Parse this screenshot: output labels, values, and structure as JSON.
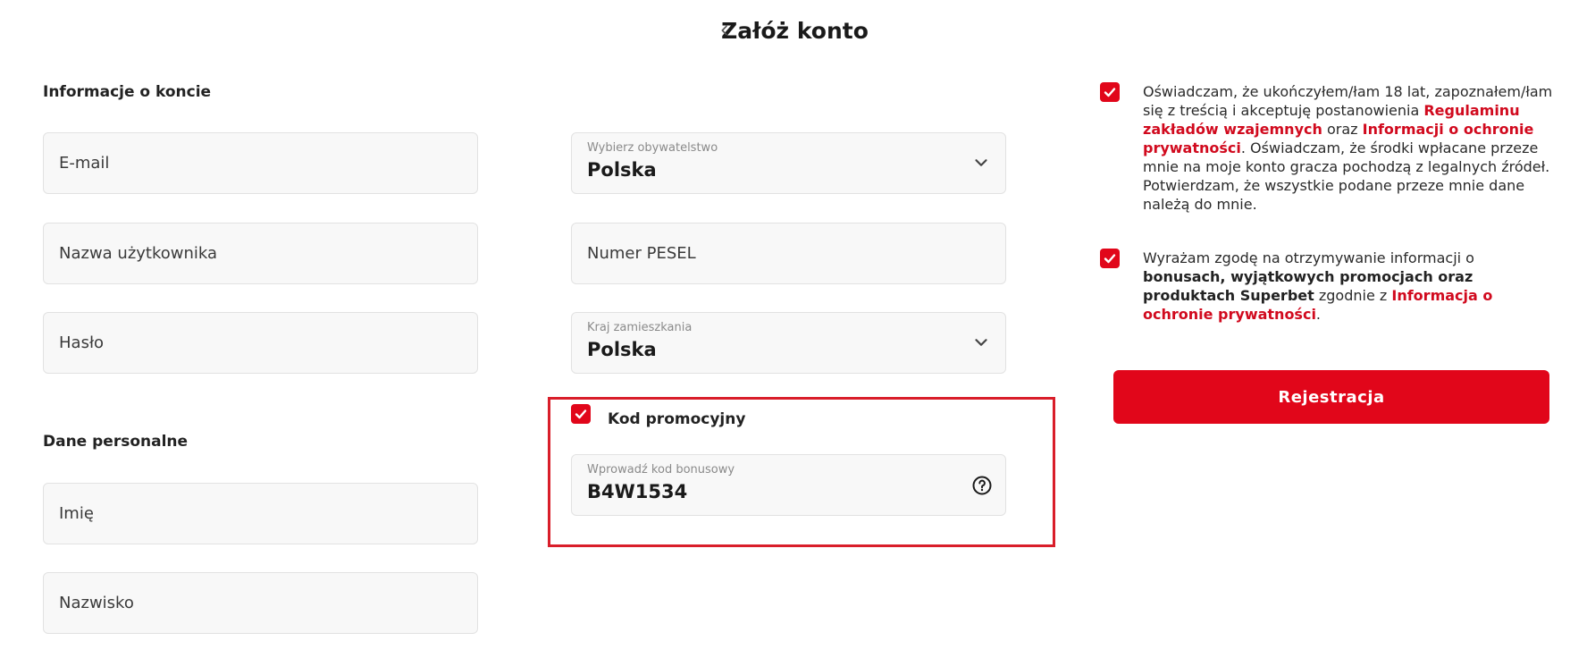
{
  "header": {
    "title": "Załóż konto",
    "back_icon": "chevron-left-icon"
  },
  "account_info": {
    "section_title": "Informacje o koncie",
    "email_placeholder": "E-mail",
    "username_placeholder": "Nazwa użytkownika",
    "password_placeholder": "Hasło"
  },
  "personal_data": {
    "section_title": "Dane personalne",
    "first_name_placeholder": "Imię",
    "last_name_placeholder": "Nazwisko"
  },
  "citizenship": {
    "label": "Wybierz obywatelstwo",
    "value": "Polska"
  },
  "pesel": {
    "placeholder": "Numer PESEL"
  },
  "residence": {
    "label": "Kraj zamieszkania",
    "value": "Polska"
  },
  "promo": {
    "checkbox_label": "Kod promocyjny",
    "checked": true,
    "code_label": "Wprowadź kod bonusowy",
    "code_value": "B4W1534",
    "highlight_color": "#d91e2a"
  },
  "consents": {
    "terms": {
      "checked": true,
      "text_1": "Oświadczam, że ukończyłem/łam 18 lat, zapoznałem/łam się z treścią i akceptuję postanowienia ",
      "link_1": "Regulaminu zakładów wzajemnych",
      "text_2": " oraz ",
      "link_2": "Informacji o ochronie prywatności",
      "text_3": ". Oświadczam, że środki wpłacane przeze mnie na moje konto gracza pochodzą z legalnych źródeł. Potwierdzam, że wszystkie podane przeze mnie dane należą do mnie."
    },
    "marketing": {
      "checked": true,
      "text_1": "Wyrażam zgodę na otrzymywanie informacji o ",
      "bold": "bonusach, wyjątkowych promocjach oraz produktach Superbet",
      "text_2": " zgodnie z ",
      "link": "Informacja o ochronie prywatności",
      "text_3": "."
    }
  },
  "register_button": {
    "label": "Rejestracja"
  },
  "colors": {
    "accent": "#e1061a",
    "link": "#d10a1e"
  }
}
